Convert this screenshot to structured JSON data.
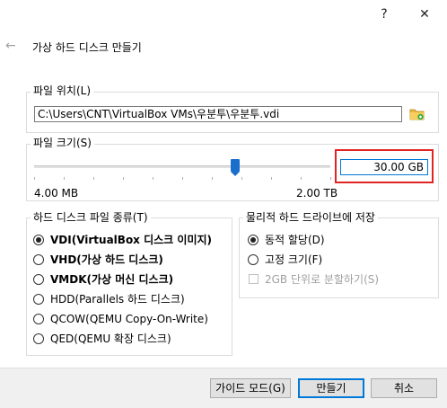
{
  "window": {
    "help_label": "?",
    "close_label": "✕",
    "back_label": "←",
    "page_title": "가상 하드 디스크 만들기"
  },
  "file_location": {
    "label": "파일 위치(L)",
    "path": "C:\\Users\\CNT\\VirtualBox VMs\\우분투\\우분투.vdi",
    "folder_icon": "folder-icon"
  },
  "file_size": {
    "label": "파일 크기(S)",
    "min_label": "4.00 MB",
    "max_label": "2.00 TB",
    "value": "30.00 GB",
    "slider_fraction": 0.68
  },
  "disk_type": {
    "label": "하드 디스크 파일 종류(T)",
    "options": [
      {
        "label": "VDI(VirtualBox 디스크 이미지)",
        "selected": true,
        "bold": true
      },
      {
        "label": "VHD(가상 하드 디스크)",
        "selected": false,
        "bold": true
      },
      {
        "label": "VMDK(가상 머신 디스크)",
        "selected": false,
        "bold": true
      },
      {
        "label": "HDD(Parallels 하드 디스크)",
        "selected": false,
        "bold": false
      },
      {
        "label": "QCOW(QEMU Copy-On-Write)",
        "selected": false,
        "bold": false
      },
      {
        "label": "QED(QEMU 확장 디스크)",
        "selected": false,
        "bold": false
      }
    ]
  },
  "storage": {
    "label": "물리적 하드 드라이브에 저장",
    "options": [
      {
        "label": "동적 할당(D)",
        "selected": true
      },
      {
        "label": "고정 크기(F)",
        "selected": false
      }
    ],
    "split_label": "2GB 단위로 분할하기(S)",
    "split_checked": false
  },
  "buttons": {
    "guided": "가이드 모드(G)",
    "create": "만들기",
    "cancel": "취소"
  },
  "colors": {
    "accent": "#0078d7",
    "highlight": "#e02424",
    "slider": "#1a6fcd"
  }
}
